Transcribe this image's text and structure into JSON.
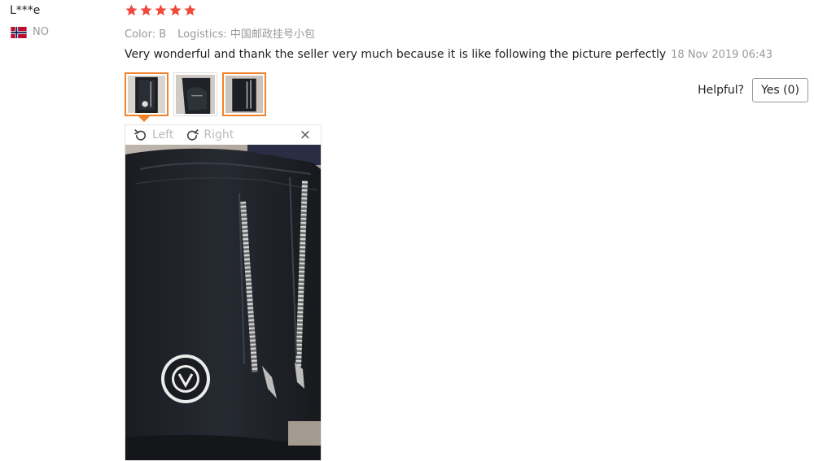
{
  "review": {
    "user_name": "L***e",
    "country_code": "NO",
    "rating": 5,
    "color_label": "Color: B",
    "logistics_label": "Logistics: 中国邮政挂号小包",
    "text": "Very wonderful and thank the seller very much because it is like following the picture perfectly",
    "date": "18 Nov 2019 06:43",
    "helpful_label": "Helpful?",
    "yes_label": "Yes (0)"
  },
  "viewer": {
    "rotate_left_label": "Left",
    "rotate_right_label": "Right",
    "close_glyph": "×"
  },
  "thumbnails": [
    {
      "name": "review-photo-1",
      "selected": true
    },
    {
      "name": "review-photo-2",
      "selected": false
    },
    {
      "name": "review-photo-3",
      "selected": false
    }
  ],
  "colors": {
    "star": "#f04a3e",
    "accent_orange": "#f0832c",
    "muted_text": "#999999"
  },
  "icons": {
    "flag": "norway-flag-icon",
    "star": "star-icon",
    "rotate_left": "rotate-left-icon",
    "rotate_right": "rotate-right-icon",
    "close": "close-icon"
  }
}
